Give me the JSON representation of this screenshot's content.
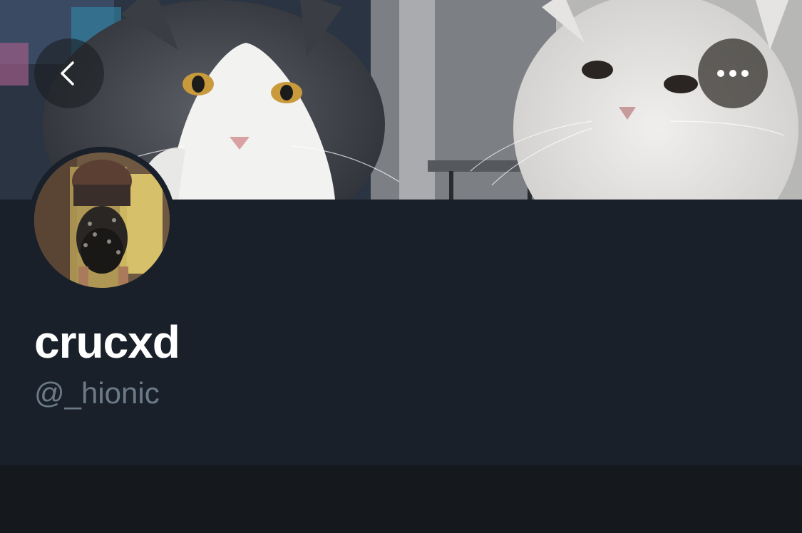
{
  "profile": {
    "display_name": "crucxd",
    "handle": "@_hionic",
    "banner": {
      "description_icon": "header-photo"
    },
    "avatar": {
      "description_icon": "profile-photo"
    }
  },
  "nav": {
    "back_icon": "chevron-left-icon",
    "more_icon": "more-horizontal-icon"
  },
  "colors": {
    "panel_bg": "#19202a",
    "page_bg": "#15181d",
    "name_text": "#ffffff",
    "handle_text": "#6c7a87"
  }
}
